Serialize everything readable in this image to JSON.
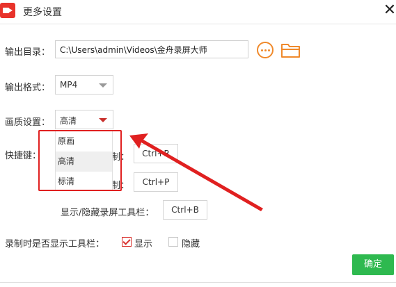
{
  "window": {
    "title": "更多设置",
    "close_glyph": "✕"
  },
  "output_dir": {
    "label": "输出目录：",
    "value": "C:\\Users\\admin\\Videos\\金舟录屏大师"
  },
  "output_format": {
    "label": "输出格式：",
    "value": "MP4"
  },
  "quality": {
    "label": "画质设置：",
    "value": "高清",
    "options": [
      "原画",
      "高清",
      "标清"
    ],
    "selected_index": 1
  },
  "hotkeys": {
    "label": "快捷键：",
    "row1": {
      "label_tail": "制：",
      "key": "Ctrl+R"
    },
    "row2": {
      "label_tail": "制：",
      "key": "Ctrl+P"
    },
    "row3": {
      "label": "显示/隐藏录屏工具栏：",
      "key": "Ctrl+B"
    }
  },
  "toolbar_visibility": {
    "label": "录制时是否显示工具栏：",
    "show_label": "显示",
    "hide_label": "隐藏",
    "show_checked": true,
    "hide_checked": false
  },
  "confirm_label": "确定",
  "colors": {
    "accent_red": "#e02020",
    "confirm_green": "#2eb94f",
    "icon_orange": "#f08a2c"
  },
  "icons": [
    "app-logo-icon",
    "close-icon",
    "more-icon",
    "folder-icon",
    "chevron-down-icon",
    "check-icon",
    "annotation-arrow"
  ]
}
